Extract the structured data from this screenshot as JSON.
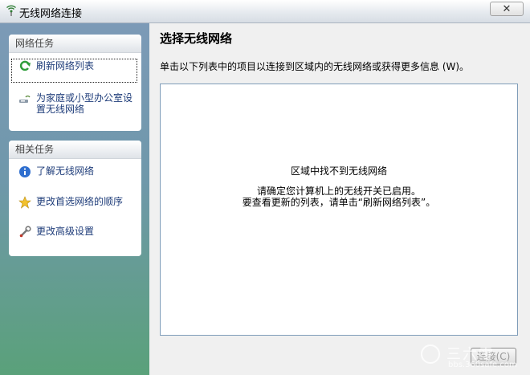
{
  "window": {
    "title": "无线网络连接",
    "close_label": "✕"
  },
  "sidebar": {
    "network_tasks": {
      "header": "网络任务",
      "items": [
        {
          "label": "刷新网络列表",
          "icon": "refresh-icon"
        },
        {
          "label": "为家庭或小型办公室设置无线网络",
          "icon": "wireless-setup-icon"
        }
      ]
    },
    "related_tasks": {
      "header": "相关任务",
      "items": [
        {
          "label": "了解无线网络",
          "icon": "info-icon"
        },
        {
          "label": "更改首选网络的顺序",
          "icon": "star-icon"
        },
        {
          "label": "更改高级设置",
          "icon": "tools-icon"
        }
      ]
    }
  },
  "main": {
    "title": "选择无线网络",
    "description": "单击以下列表中的项目以连接到区域内的无线网络或获得更多信息 (W)。",
    "empty_message": "区域中找不到无线网络",
    "hint_line1": "请确定您计算机上的无线开关已启用。",
    "hint_line2": "要查看更新的列表，请单击“刷新网络列表”。",
    "connect_label": "连接(C)"
  },
  "watermark": {
    "brand": "三六零",
    "url": "bbs.360safe.com"
  },
  "colors": {
    "link": "#1f3d7a",
    "sidebar_top": "#7c9ab7",
    "sidebar_bottom": "#5aa17a"
  }
}
